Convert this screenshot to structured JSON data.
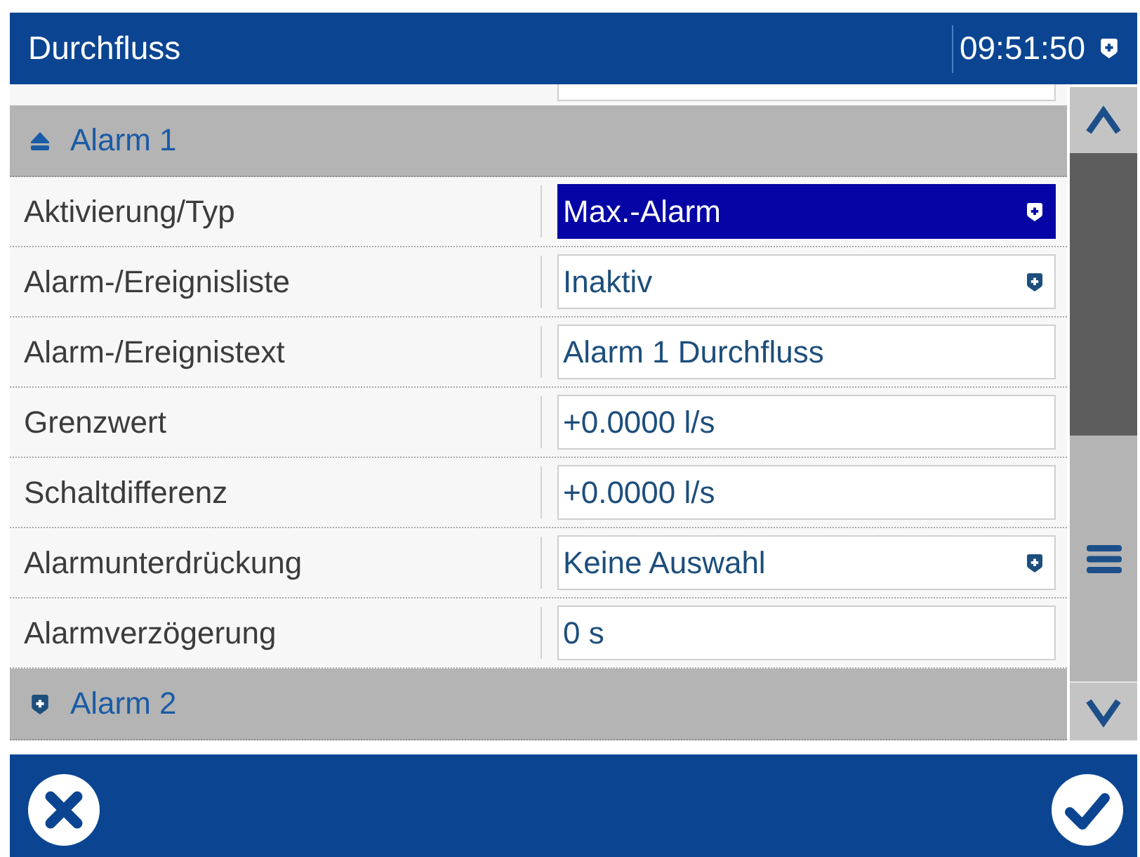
{
  "title_bar": {
    "title": "Durchfluss",
    "time": "09:51:50"
  },
  "sections": [
    {
      "title": "Alarm 1",
      "expanded": true,
      "rows": [
        {
          "label": "Aktivierung/Typ",
          "value": "Max.-Alarm",
          "kind": "dropdown",
          "selected": true
        },
        {
          "label": "Alarm-/Ereignisliste",
          "value": "Inaktiv",
          "kind": "dropdown",
          "selected": false
        },
        {
          "label": "Alarm-/Ereignistext",
          "value": "Alarm 1 Durchfluss",
          "kind": "text",
          "selected": false
        },
        {
          "label": "Grenzwert",
          "value": "+0.0000 l/s",
          "kind": "text",
          "selected": false
        },
        {
          "label": "Schaltdifferenz",
          "value": "+0.0000 l/s",
          "kind": "text",
          "selected": false
        },
        {
          "label": "Alarmunterdrückung",
          "value": "Keine Auswahl",
          "kind": "dropdown",
          "selected": false
        },
        {
          "label": "Alarmverzögerung",
          "value": "0 s",
          "kind": "text",
          "selected": false
        }
      ]
    },
    {
      "title": "Alarm 2",
      "expanded": false
    }
  ]
}
